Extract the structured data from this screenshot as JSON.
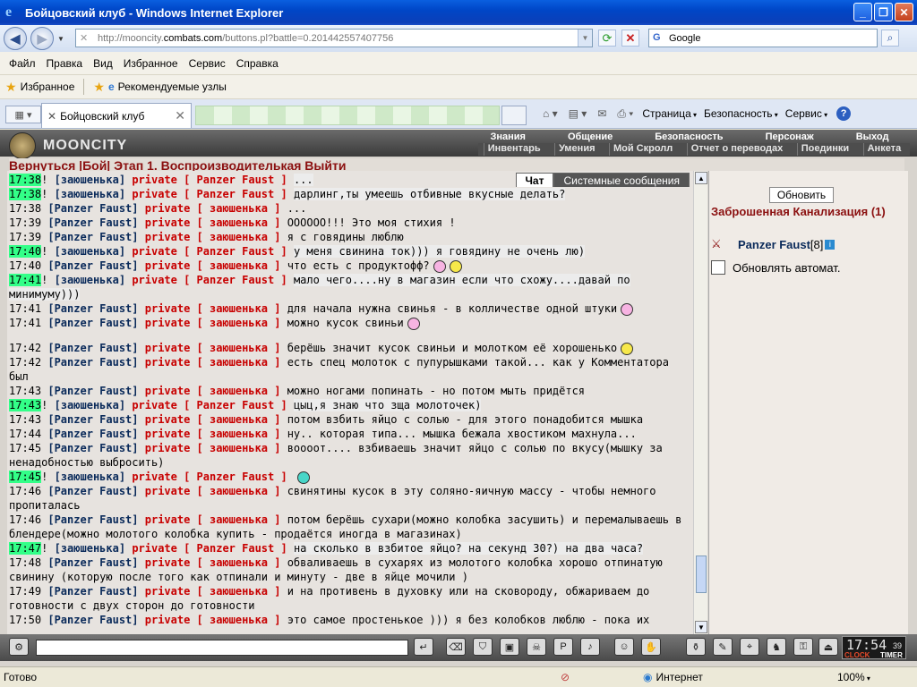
{
  "window": {
    "title": "Бойцовский клуб - Windows Internet Explorer"
  },
  "address": {
    "url_prefix": "http://mooncity.",
    "url_host": "combats.com",
    "url_rest": "/buttons.pl?battle=0.201442557407756",
    "search_placeholder": "Google"
  },
  "menu": [
    "Файл",
    "Правка",
    "Вид",
    "Избранное",
    "Сервис",
    "Справка"
  ],
  "favorites": {
    "label": "Избранное",
    "suggested": "Рекомендуемые узлы"
  },
  "tab": {
    "title": "Бойцовский клуб"
  },
  "commandbar": {
    "page": "Страница",
    "safety": "Безопасность",
    "tools": "Сервис"
  },
  "game": {
    "logo": "MOONCITY",
    "nav1": [
      "Знания",
      "Общение",
      "Безопасность",
      "Персонаж",
      "Выход"
    ],
    "nav2": [
      "Инвентарь",
      "Умения",
      "Мой Скролл",
      "Отчет о переводах",
      "Поединки",
      "Анкета"
    ],
    "redline": "Вернуться   |Бой|           Этап 1.  Воспроизводителькая   Выйти",
    "chat_tabs": {
      "chat": "Чат",
      "system": "Системные сообщения"
    },
    "messages": [
      {
        "t": "17:38",
        "hl": true,
        "from": "заюшенька",
        "to": "Panzer Faust",
        "msg": "...",
        "bg": true
      },
      {
        "t": "17:38",
        "hl": true,
        "from": "заюшенька",
        "to": "Panzer Faust",
        "msg": "дарлинг,ты умеешь отбивные вкусные делать?",
        "bg": true
      },
      {
        "t": "17:38",
        "hl": false,
        "from": "Panzer Faust",
        "to": "заюшенька",
        "msg": "...",
        "bg": false
      },
      {
        "t": "17:39",
        "hl": false,
        "from": "Panzer Faust",
        "to": "заюшенька",
        "msg": "ОООООО!!! Это моя стихия !",
        "bg": false
      },
      {
        "t": "17:39",
        "hl": false,
        "from": "Panzer Faust",
        "to": "заюшенька",
        "msg": "я с говядины люблю",
        "bg": false
      },
      {
        "t": "17:40",
        "hl": true,
        "from": "заюшенька",
        "to": "Panzer Faust",
        "msg": "у меня свинина ток))) я говядину не очень лю)",
        "bg": true
      },
      {
        "t": "17:40",
        "hl": false,
        "from": "Panzer Faust",
        "to": "заюшенька",
        "msg": "что есть с продуктофф?",
        "bg": false,
        "emo": [
          "pink",
          "yellow"
        ]
      },
      {
        "t": "17:41",
        "hl": true,
        "from": "заюшенька",
        "to": "Panzer Faust",
        "msg": "мало чего....ну в магазин если что схожу....давай по минимуму)))",
        "bg": true
      },
      {
        "t": "17:41",
        "hl": false,
        "from": "Panzer Faust",
        "to": "заюшенька",
        "msg": "для начала нужна свинья - в колличестве одной штуки",
        "bg": false,
        "emo": [
          "pink"
        ]
      },
      {
        "t": "17:41",
        "hl": false,
        "from": "Panzer Faust",
        "to": "заюшенька",
        "msg": "можно кусок свиньи",
        "bg": false,
        "emo": [
          "pink"
        ]
      },
      {
        "t": "17:42",
        "hl": false,
        "from": "Panzer Faust",
        "to": "заюшенька",
        "msg": "берёшь значит кусок свиньи и молотком её хорошенько",
        "bg": false,
        "emo": [
          "hammer"
        ],
        "gap": true
      },
      {
        "t": "17:42",
        "hl": false,
        "from": "Panzer Faust",
        "to": "заюшенька",
        "msg": "есть спец молоток с пупурышками такой... как у Комментатора был",
        "bg": false
      },
      {
        "t": "17:43",
        "hl": false,
        "from": "Panzer Faust",
        "to": "заюшенька",
        "msg": "можно ногами попинать - но потом мыть придётся",
        "bg": false
      },
      {
        "t": "17:43",
        "hl": true,
        "from": "заюшенька",
        "to": "Panzer Faust",
        "msg": "цыц,я знаю что зща молоточек)",
        "bg": true
      },
      {
        "t": "17:43",
        "hl": false,
        "from": "Panzer Faust",
        "to": "заюшенька",
        "msg": "потом взбить яйцо с солью - для этого понадобится мышка",
        "bg": false
      },
      {
        "t": "17:44",
        "hl": false,
        "from": "Panzer Faust",
        "to": "заюшенька",
        "msg": "ну.. которая типа... мышка бежала хвостиком махнула...",
        "bg": false
      },
      {
        "t": "17:45",
        "hl": false,
        "from": "Panzer Faust",
        "to": "заюшенька",
        "msg": "воооот.... взбиваешь значит яйцо с солью по вкусу(мышку за ненадобностью выбросить)",
        "bg": false
      },
      {
        "t": "17:45",
        "hl": true,
        "from": "заюшенька",
        "to": "Panzer Faust",
        "msg": "",
        "bg": true,
        "emo": [
          "teal"
        ]
      },
      {
        "t": "17:46",
        "hl": false,
        "from": "Panzer Faust",
        "to": "заюшенька",
        "msg": "свинятины кусок в эту соляно-яичную массу - чтобы немного пропиталась",
        "bg": false
      },
      {
        "t": "17:46",
        "hl": false,
        "from": "Panzer Faust",
        "to": "заюшенька",
        "msg": "потом берёшь сухари(можно колобка засушить) и перемалываешь в блендере(можно молотого колобка купить - продаётся иногда в магазинах)",
        "bg": false
      },
      {
        "t": "17:47",
        "hl": true,
        "from": "заюшенька",
        "to": "Panzer Faust",
        "msg": "на сколько в взбитое яйцо? на секунд 30?) на два часа?",
        "bg": true
      },
      {
        "t": "17:48",
        "hl": false,
        "from": "Panzer Faust",
        "to": "заюшенька",
        "msg": "обваливаешь в сухарях из молотого колобка хорошо отпинатую свинину (которую после того как отпинали и минуту - две в яйце мочили )",
        "bg": false
      },
      {
        "t": "17:49",
        "hl": false,
        "from": "Panzer Faust",
        "to": "заюшенька",
        "msg": "и на противень в духовку или на сковороду, обжариваем до готовности с двух сторон до готовности",
        "bg": false
      },
      {
        "t": "17:50",
        "hl": false,
        "from": "Panzer Faust",
        "to": "заюшенька",
        "msg": "это самое простенькое ))) я без колобков люблю - пока их",
        "bg": false
      }
    ],
    "private_label": "private",
    "right_panel": {
      "refresh": "Обновить",
      "location": "Заброшенная Канализация (1)",
      "user": "Panzer Faust",
      "level": "[8]",
      "auto_refresh": "Обновлять автомат."
    },
    "clock": {
      "time": "17:54",
      "sec": "39",
      "label_clock": "CLOCK",
      "label_timer": "TIMER"
    }
  },
  "status": {
    "text": "Готово",
    "zone": "Интернет",
    "zoom": "100%"
  }
}
